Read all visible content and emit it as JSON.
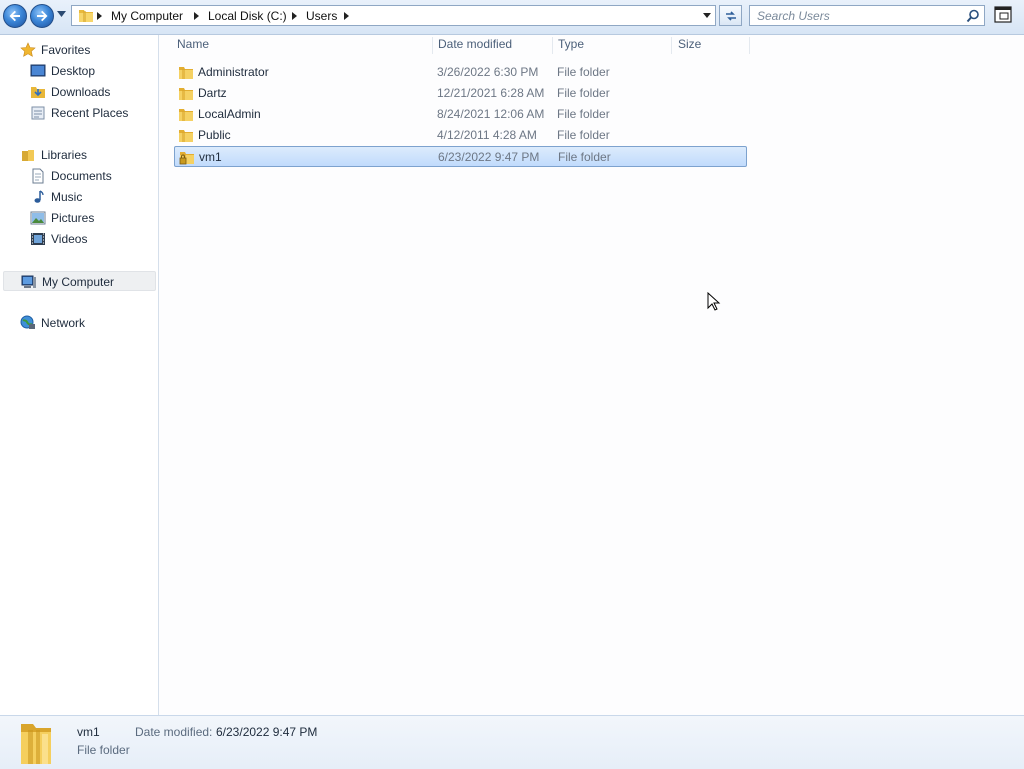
{
  "address_bar": {
    "breadcrumbs": [
      "My Computer",
      "Local Disk (C:)",
      "Users"
    ]
  },
  "search": {
    "placeholder": "Search Users"
  },
  "nav_pane": {
    "favorites": {
      "label": "Favorites",
      "items": [
        "Desktop",
        "Downloads",
        "Recent Places"
      ]
    },
    "libraries": {
      "label": "Libraries",
      "items": [
        "Documents",
        "Music",
        "Pictures",
        "Videos"
      ]
    },
    "computer": {
      "label": "My Computer"
    },
    "network": {
      "label": "Network"
    }
  },
  "columns": {
    "name": "Name",
    "date_modified": "Date modified",
    "type": "Type",
    "size": "Size"
  },
  "files": [
    {
      "name": "Administrator",
      "date": "3/26/2022 6:30 PM",
      "type": "File folder",
      "selected": false
    },
    {
      "name": "Dartz",
      "date": "12/21/2021 6:28 AM",
      "type": "File folder",
      "selected": false
    },
    {
      "name": "LocalAdmin",
      "date": "8/24/2021 12:06 AM",
      "type": "File folder",
      "selected": false
    },
    {
      "name": "Public",
      "date": "4/12/2011 4:28 AM",
      "type": "File folder",
      "selected": false
    },
    {
      "name": "vm1",
      "date": "6/23/2022 9:47 PM",
      "type": "File folder",
      "selected": true
    }
  ],
  "details": {
    "name": "vm1",
    "type": "File folder",
    "date_label": "Date modified:",
    "date_value": "6/23/2022 9:47 PM"
  },
  "colors": {
    "selection_fill": "#c9e0fc",
    "selection_border": "#7da2ce",
    "folder_yellow": "#f4c94a"
  },
  "icons": {
    "back": "back-arrow-icon",
    "forward": "forward-arrow-icon",
    "refresh": "refresh-icon",
    "search": "magnifier-icon",
    "folder": "folder-icon"
  }
}
